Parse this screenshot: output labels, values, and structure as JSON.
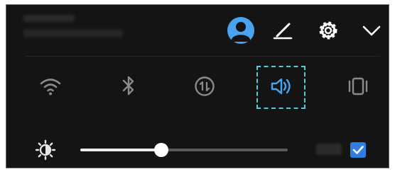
{
  "colors": {
    "panel_background": "#141414",
    "icon_white": "#ffffff",
    "icon_dim": "#8a8a8a",
    "sound_active": "#4aa3ef",
    "highlight_outline": "#4fd0d8",
    "checkbox_blue": "#2e7fe0",
    "slider_fill": "#ededed",
    "slider_track": "#5a5a5a"
  },
  "header": {
    "icons": [
      "avatar-icon",
      "edit-pencil-icon",
      "settings-gear-icon",
      "expand-chevron-down-icon"
    ]
  },
  "toggles": [
    {
      "icon": "wifi-icon",
      "active": false
    },
    {
      "icon": "bluetooth-icon",
      "active": false
    },
    {
      "icon": "mobile-data-icon",
      "active": false
    },
    {
      "icon": "sound-icon",
      "active": true,
      "highlighted": true
    },
    {
      "icon": "vibrate-icon",
      "active": false
    }
  ],
  "brightness": {
    "icon": "brightness-icon",
    "level": 0.39,
    "auto_checked": true
  }
}
